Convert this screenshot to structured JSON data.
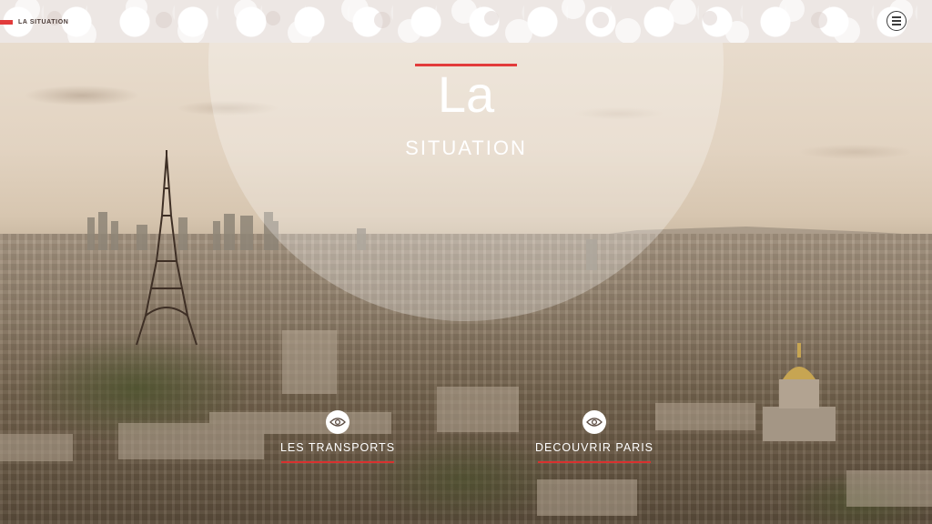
{
  "header": {
    "section_tag": "LA SITUATION",
    "menu_icon": "hamburger-menu-icon"
  },
  "hero": {
    "title": "La",
    "subtitle": "SITUATION"
  },
  "actions": [
    {
      "label": "LES TRANSPORTS",
      "icon": "eye-icon"
    },
    {
      "label": "DECOUVRIR PARIS",
      "icon": "eye-icon"
    }
  ],
  "colors": {
    "accent": "#e23b3b",
    "text_light": "#ffffff"
  }
}
